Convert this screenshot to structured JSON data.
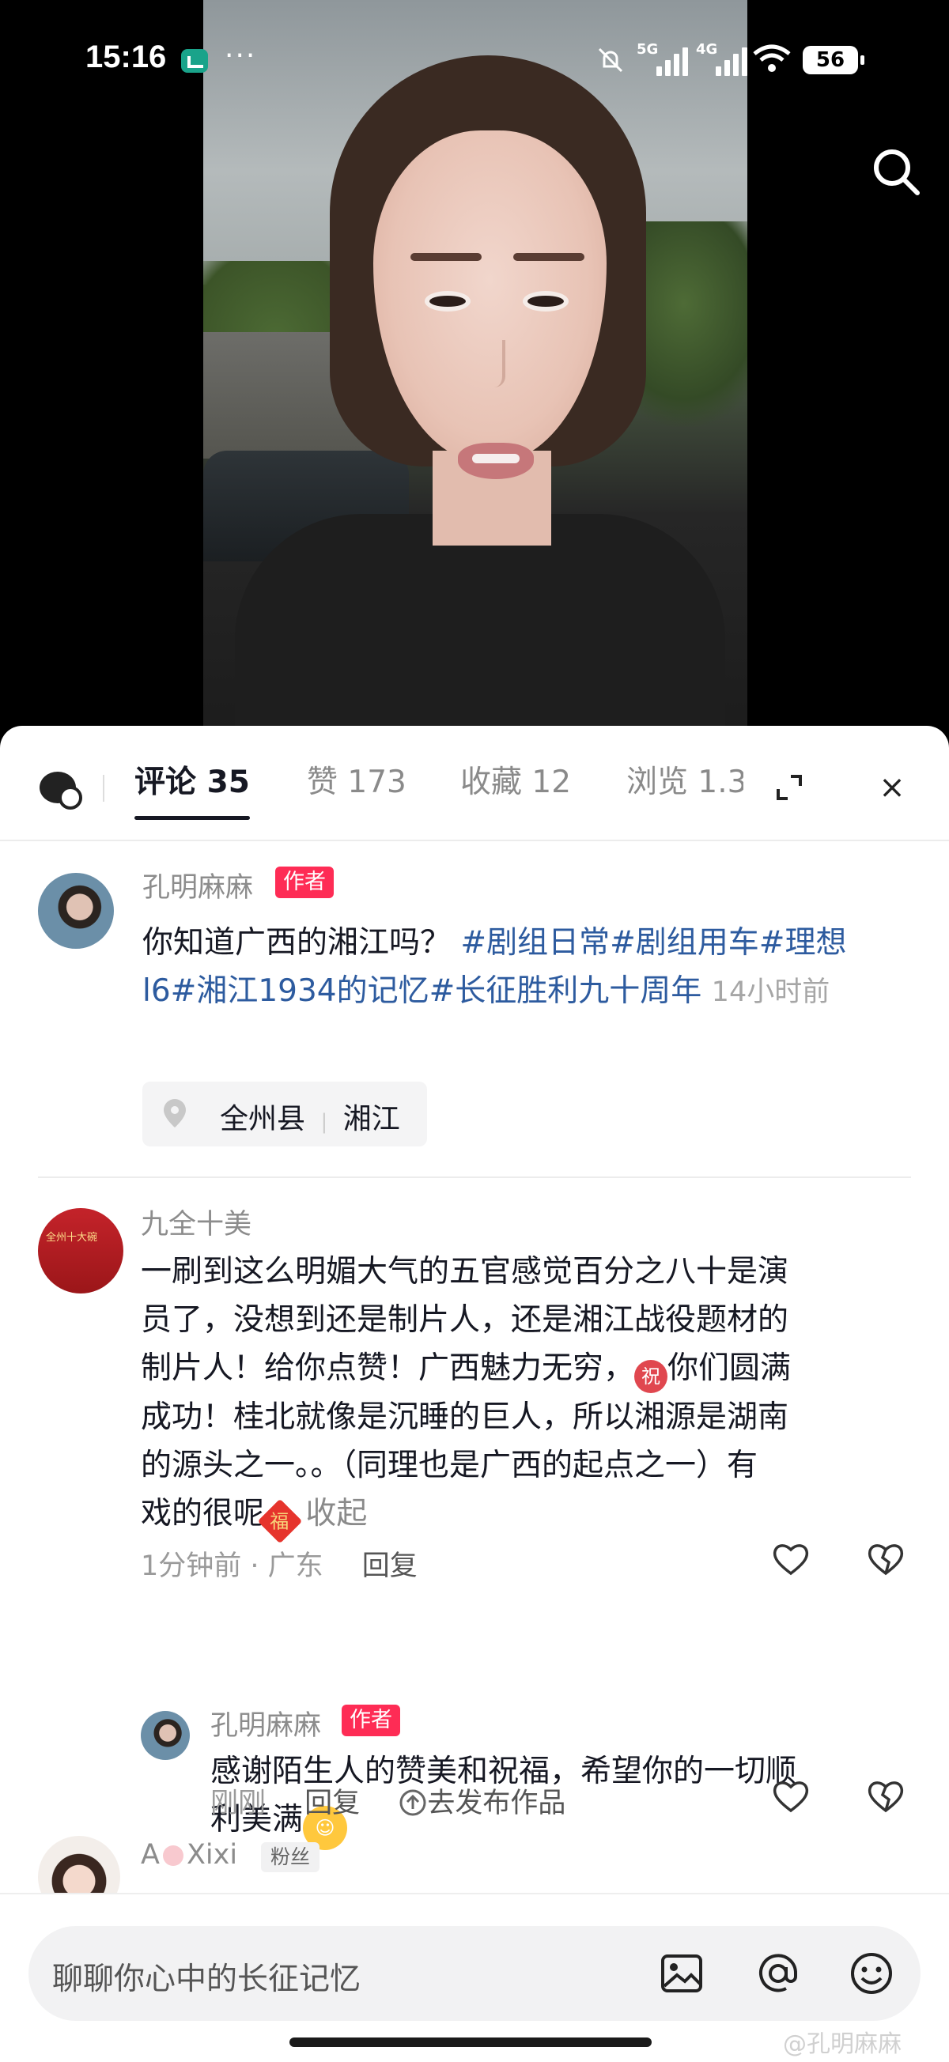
{
  "status_bar": {
    "time": "15:16",
    "dots": "···",
    "sig1": "5G",
    "sig2": "4G",
    "battery": "56"
  },
  "tabs": [
    {
      "label": "评论 35"
    },
    {
      "label": "赞 173"
    },
    {
      "label": "收藏 12"
    },
    {
      "label": "浏览 1.3"
    }
  ],
  "close_glyph": "×",
  "post": {
    "author": "孔明麻麻",
    "badge": "作者",
    "text": "你知道广西的湘江吗？",
    "tags_line1": "#剧组日常#剧组用车#理想",
    "tags_line2": "l6#湘江1934的记忆#长征胜利九十周年",
    "time": "14小时前",
    "location_county": "全州县",
    "location_sep": "|",
    "location_place": "湘江"
  },
  "comment1": {
    "user": "九全十美",
    "avatar_text": "全州十大碗",
    "line1": "一刷到这么明媚大气的五官感觉百分之八十是演",
    "line2": "员了，没想到还是制片人，还是湘江战役题材的",
    "line3": "制片人！给你点赞！广西魅力无穷，",
    "emoji_zhu": "祝",
    "line3b": "你们圆满",
    "line4": "成功！桂北就像是沉睡的巨人，所以湘源是湖南",
    "line5": "的源头之一。。（同理也是广西的起点之一）有",
    "line6": "戏的很呢",
    "emoji_fu": "福",
    "collapse": "收起",
    "meta": "1分钟前 · 广东",
    "reply": "回复"
  },
  "reply1": {
    "user": "孔明麻麻",
    "badge": "作者",
    "line1": "感谢陌生人的赞美和祝福，希望你的一切顺",
    "line2": "利美满",
    "time": "刚刚",
    "reply": "回复",
    "publish": "去发布作品"
  },
  "comment2": {
    "user_prefix": "A",
    "user_suffix": "Xixi",
    "badge": "粉丝"
  },
  "input": {
    "placeholder": "聊聊你心中的长征记忆"
  },
  "watermark": "@孔明麻麻",
  "colors": {
    "accent": "#fe2c55",
    "tag": "#2d5b9f",
    "text": "#161823"
  },
  "icons": [
    "search-icon",
    "chat-bot-icon",
    "expand-icon",
    "close-icon",
    "location-pin-icon",
    "heart-icon",
    "dislike-icon",
    "image-icon",
    "at-icon",
    "emoji-icon",
    "publish-icon"
  ]
}
